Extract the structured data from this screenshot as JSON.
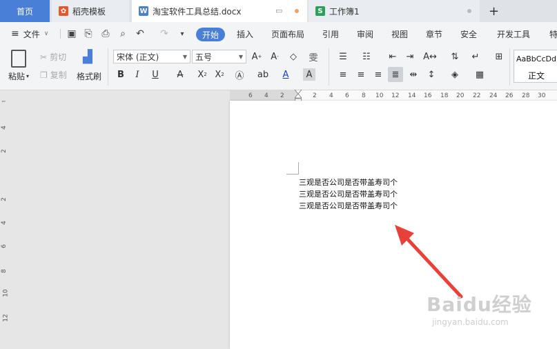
{
  "tabs": {
    "home": "首页",
    "template": "稻壳模板",
    "doc": "淘宝软件工具总结.docx",
    "sheet": "工作簿1",
    "add": "+"
  },
  "menu": {
    "file": "文件",
    "items": [
      "开始",
      "插入",
      "页面布局",
      "引用",
      "审阅",
      "视图",
      "章节",
      "安全",
      "开发工具",
      "特"
    ]
  },
  "ribbon": {
    "paste": "粘贴",
    "cut": "剪切",
    "copy": "复制",
    "format_painter": "格式刷",
    "font_name": "宋体 (正文)",
    "font_size": "五号",
    "style_preview": "AaBbCcDd",
    "style_name": "正文"
  },
  "ruler": {
    "h_left": [
      "6",
      "4",
      "2"
    ],
    "h_right": [
      "2",
      "4",
      "6",
      "8",
      "10",
      "12",
      "14",
      "16",
      "18",
      "20",
      "22",
      "24",
      "26",
      "28",
      "30"
    ],
    "v": [
      "4",
      "2",
      "2",
      "4",
      "6",
      "8",
      "10",
      "12"
    ]
  },
  "document": {
    "lines": [
      "三观是否公司是否带盖寿司个",
      "三观是否公司是否带盖寿司个",
      "三观是否公司是否带盖寿司个"
    ]
  },
  "watermark": {
    "main": "Baidu经验",
    "sub": "jingyan.baidu.com"
  },
  "colors": {
    "accent": "#4a7fd8",
    "arrow": "#e8413a",
    "doc_close_dot": "#f0a35a"
  }
}
